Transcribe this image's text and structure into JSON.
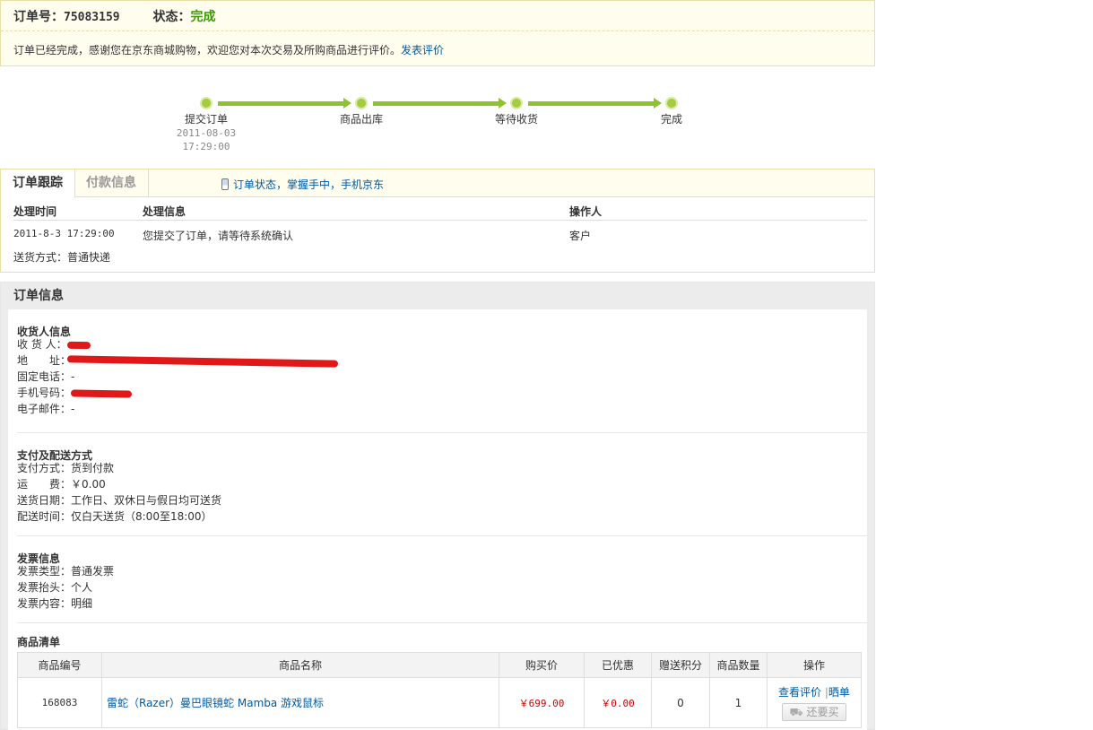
{
  "header": {
    "order_label": "订单号：",
    "order_number": "75083159",
    "status_label": "状态：",
    "status_value": "完成",
    "message": "订单已经完成，感谢您在京东商城购物，欢迎您对本次交易及所购商品进行评价。",
    "review_link": "发表评价"
  },
  "progress": {
    "steps": [
      {
        "label": "提交订单",
        "date": "2011-08-03",
        "time": "17:29:00"
      },
      {
        "label": "商品出库"
      },
      {
        "label": "等待收货"
      },
      {
        "label": "完成"
      }
    ],
    "color": "#8fc231"
  },
  "tracking": {
    "tabs": [
      "订单跟踪",
      "付款信息"
    ],
    "mobile_link": "订单状态，掌握手中，手机京东",
    "columns": [
      "处理时间",
      "处理信息",
      "操作人"
    ],
    "rows": [
      {
        "time": "2011-8-3 17:29:00",
        "info": "您提交了订单，请等待系统确认",
        "operator": "客户"
      }
    ],
    "delivery": "送货方式：普通快递"
  },
  "order_info": {
    "title": "订单信息",
    "receiver": {
      "title": "收货人信息",
      "name_label": "收 货 人：",
      "address_label": "地　　址：",
      "phone_label": "固定电话：",
      "phone_value": "-",
      "mobile_label": "手机号码：",
      "email_label": "电子邮件：",
      "email_value": "-"
    },
    "payment": {
      "title": "支付及配送方式",
      "pay_method": "支付方式：货到付款",
      "freight": "运　　费：￥0.00",
      "delivery_date": "送货日期：工作日、双休日与假日均可送货",
      "delivery_time": "配送时间：仅白天送货（8:00至18:00）"
    },
    "invoice": {
      "title": "发票信息",
      "type": "发票类型：普通发票",
      "head": "发票抬头：个人",
      "content": "发票内容：明细"
    },
    "products": {
      "title": "商品清单",
      "columns": [
        "商品编号",
        "商品名称",
        "购买价",
        "已优惠",
        "赠送积分",
        "商品数量",
        "操作"
      ],
      "rows": [
        {
          "id": "168083",
          "name": "雷蛇（Razer）曼巴眼镜蛇 Mamba 游戏鼠标",
          "price": "￥699.00",
          "discount": "￥0.00",
          "points": "0",
          "qty": "1",
          "op_review": "查看评价",
          "op_share": "晒单",
          "op_buy": "还要买"
        }
      ]
    }
  }
}
